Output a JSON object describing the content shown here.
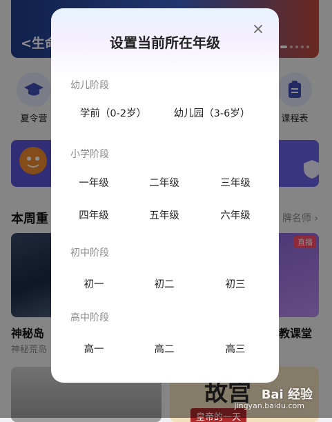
{
  "background": {
    "banner_text": "<生命",
    "icons": [
      {
        "label": "夏令营",
        "icon": "graduation-cap-icon"
      },
      {
        "label": "课程表",
        "icon": "clipboard-icon"
      }
    ],
    "section_title": "本周重",
    "section_more": "牌名师 ›",
    "card_left_title": "神秘岛",
    "card_left_sub": "神秘荒岛",
    "card_right_title": "教课堂",
    "live_badge": "直播",
    "palace_title": "故宫",
    "palace_sub": "皇帝的一天",
    "watermark": "Bai 经验",
    "watermark_sub": "jingyan.baidu.com"
  },
  "modal": {
    "title": "设置当前所在年级",
    "close_icon": "close-icon",
    "stages": [
      {
        "label": "幼儿阶段",
        "grades": [
          "学前（0-2岁）",
          "幼儿园（3-6岁）"
        ]
      },
      {
        "label": "小学阶段",
        "grades": [
          "一年级",
          "二年级",
          "三年级",
          "四年级",
          "五年级",
          "六年级"
        ]
      },
      {
        "label": "初中阶段",
        "grades": [
          "初一",
          "初二",
          "初三"
        ]
      },
      {
        "label": "高中阶段",
        "grades": [
          "高一",
          "高二",
          "高三"
        ]
      }
    ]
  },
  "colors": {
    "overlay": "#000000",
    "accent_purple": "#6b62e8",
    "stage_label": "#8a8a8a"
  }
}
